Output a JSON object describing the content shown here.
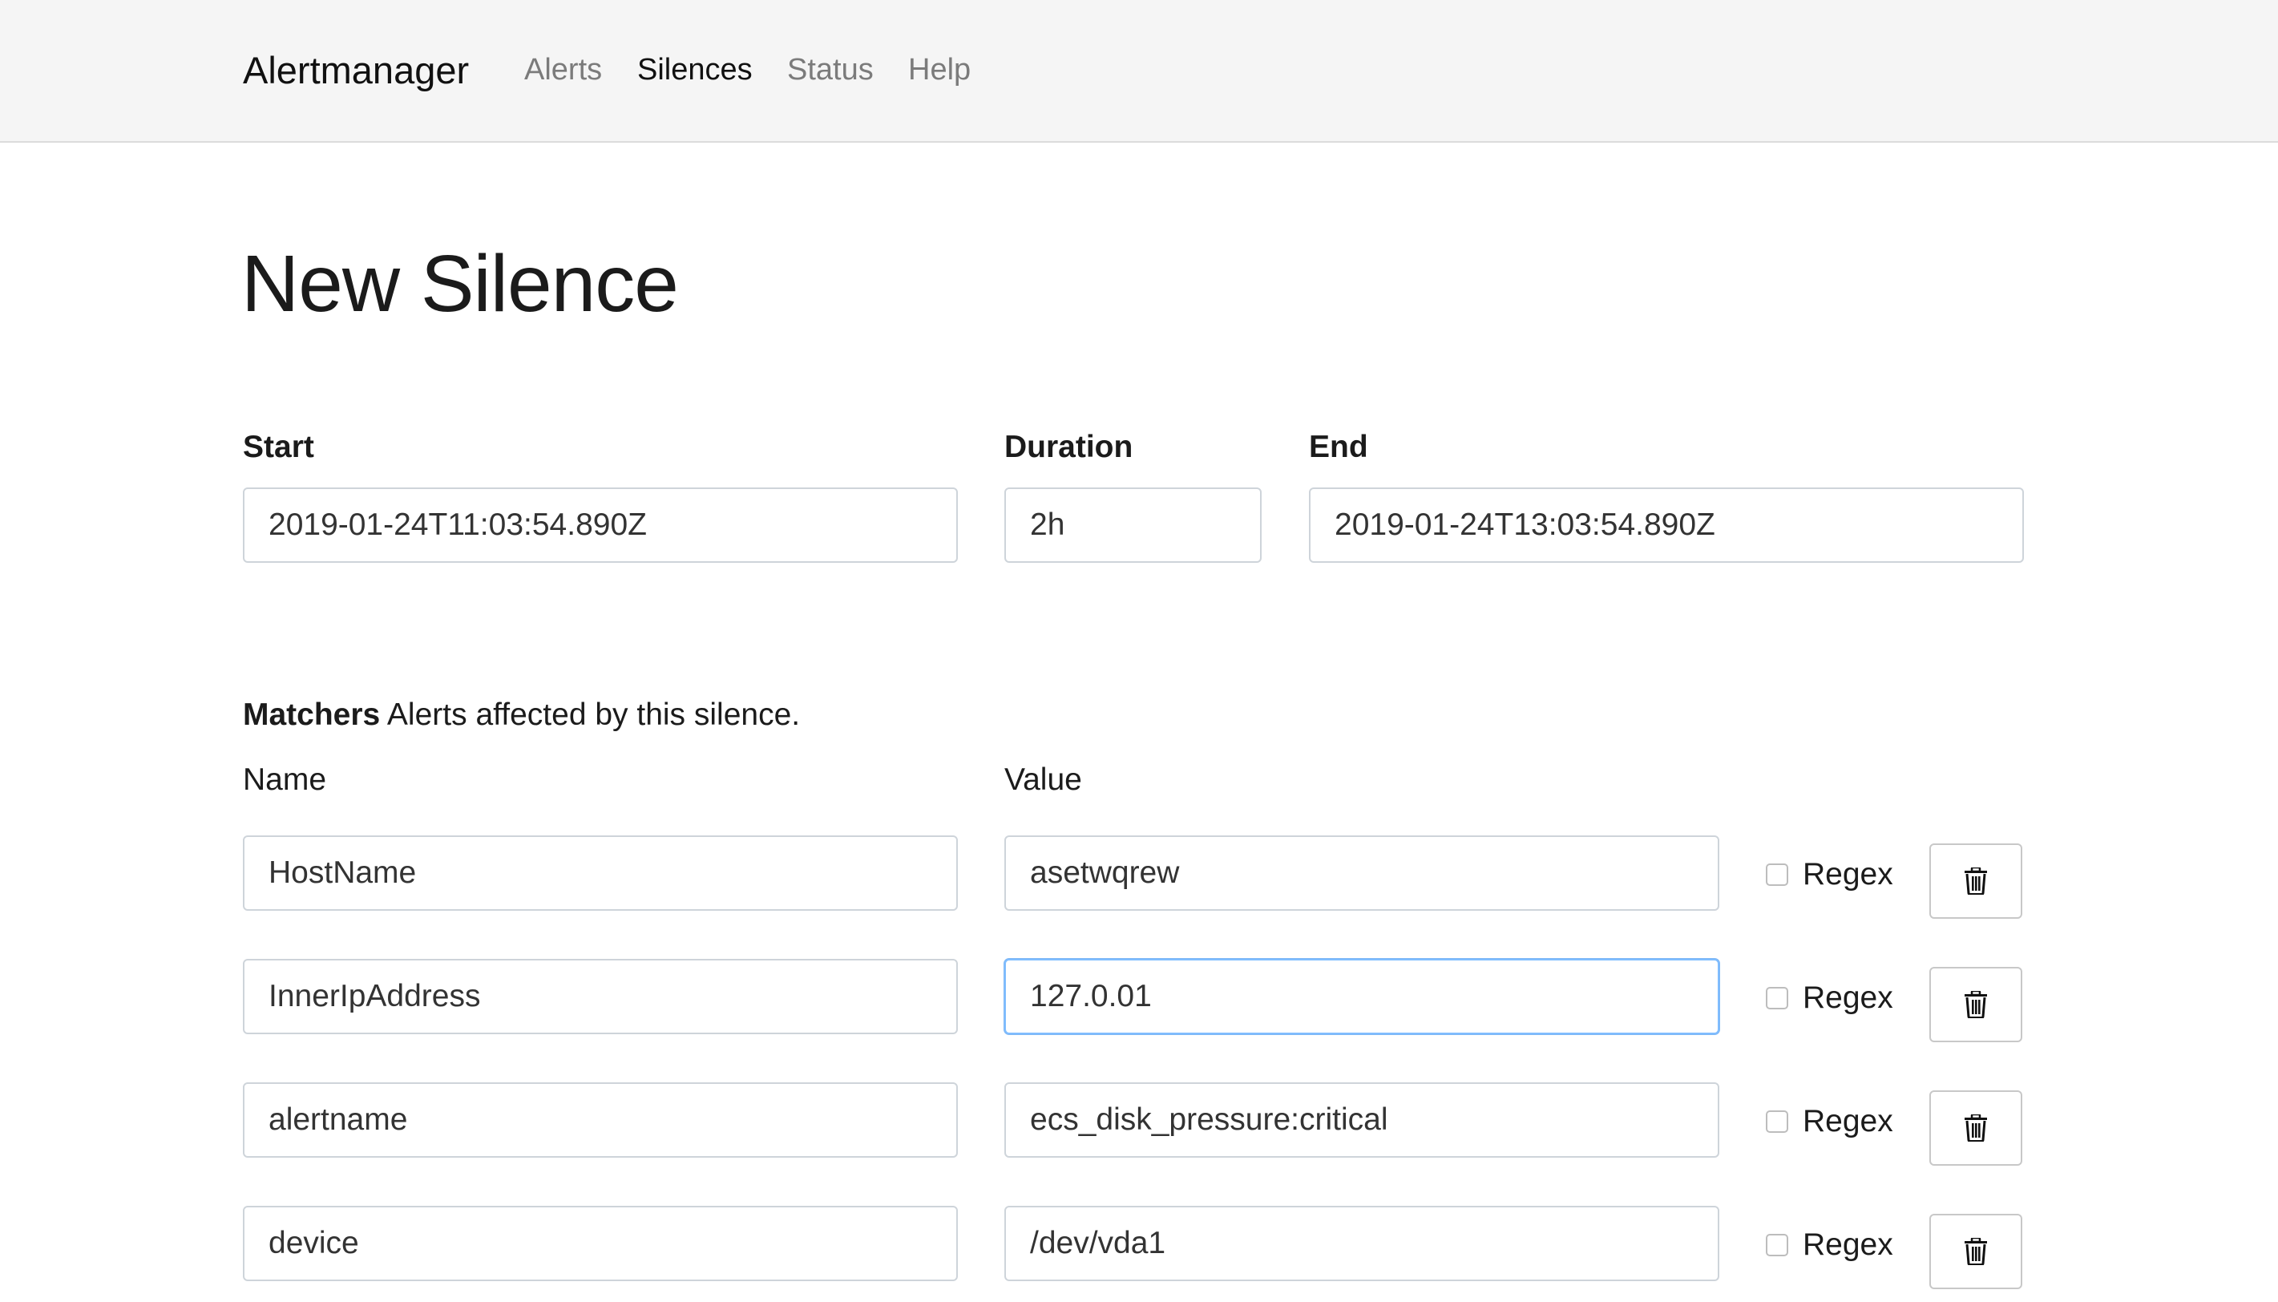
{
  "navbar": {
    "brand": "Alertmanager",
    "items": [
      {
        "label": "Alerts",
        "active": false
      },
      {
        "label": "Silences",
        "active": true
      },
      {
        "label": "Status",
        "active": false
      },
      {
        "label": "Help",
        "active": false
      }
    ]
  },
  "page": {
    "title": "New Silence"
  },
  "form": {
    "start": {
      "label": "Start",
      "value": "2019-01-24T11:03:54.890Z"
    },
    "duration": {
      "label": "Duration",
      "value": "2h"
    },
    "end": {
      "label": "End",
      "value": "2019-01-24T13:03:54.890Z"
    }
  },
  "matchers": {
    "heading": "Matchers",
    "description": "Alerts affected by this silence.",
    "name_column": "Name",
    "value_column": "Value",
    "regex_label": "Regex",
    "rows": [
      {
        "name": "HostName",
        "value": "asetwqrew",
        "regex": false
      },
      {
        "name": "InnerIpAddress",
        "value": "127.0.01",
        "regex": false,
        "focused": true
      },
      {
        "name": "alertname",
        "value": "ecs_disk_pressure:critical",
        "regex": false
      },
      {
        "name": "device",
        "value": "/dev/vda1",
        "regex": false
      }
    ]
  },
  "icons": {
    "delete": "trash-icon"
  },
  "colors": {
    "navbar_bg": "#f5f5f5",
    "focus_border": "#80bdff",
    "input_border": "#ced4da"
  }
}
